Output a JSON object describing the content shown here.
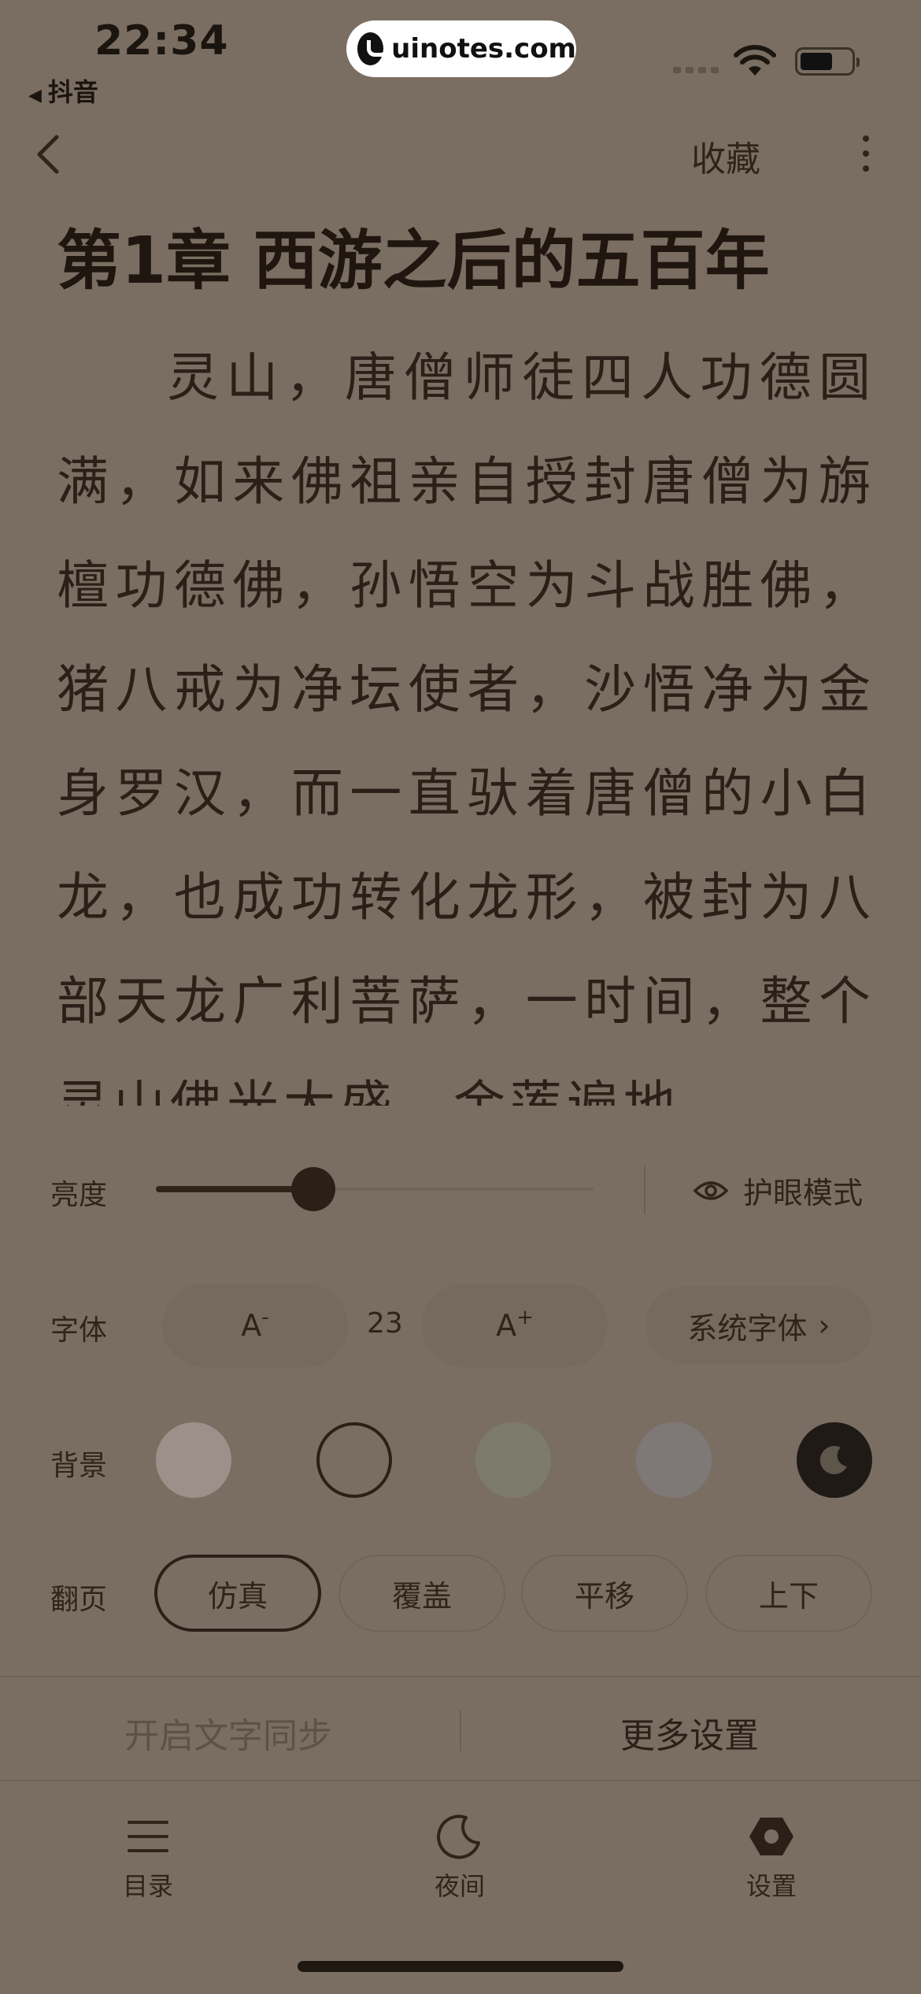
{
  "status_bar": {
    "time": "22:34",
    "back_app": "抖音",
    "watermark": "uinotes.com"
  },
  "header": {
    "favorite_label": "收藏"
  },
  "reader": {
    "chapter_title": "第1章 西游之后的五百年",
    "paragraph": "灵山，唐僧师徒四人功德圆满，如来佛祖亲自授封唐僧为旃檀功德佛，孙悟空为斗战胜佛，猪八戒为净坛使者，沙悟净为金身罗汉，而一直驮着唐僧的小白龙，也成功转化龙形，被封为八部天龙广利菩萨，一时间，整个灵山佛光大盛，金莲遍地"
  },
  "settings": {
    "brightness": {
      "label": "亮度",
      "level": 0.36,
      "eye_mode_label": "护眼模式"
    },
    "font": {
      "label": "字体",
      "decrease": "A",
      "decrease_sup": "-",
      "size": "23",
      "increase": "A",
      "increase_sup": "+",
      "system_font": "系统字体"
    },
    "background": {
      "label": "背景",
      "swatches": [
        {
          "name": "light",
          "color": "#9b918a"
        },
        {
          "name": "beige",
          "color": "#7a6e62"
        },
        {
          "name": "green",
          "color": "#7d7b6b"
        },
        {
          "name": "gray",
          "color": "#7e7877"
        },
        {
          "name": "night",
          "color": "#1f1a15"
        }
      ],
      "selected": "beige"
    },
    "page_turn": {
      "label": "翻页",
      "options": [
        "仿真",
        "覆盖",
        "平移",
        "上下"
      ],
      "selected": "仿真"
    },
    "sync_text": "开启文字同步",
    "more_settings": "更多设置"
  },
  "tabs": [
    {
      "label": "目录",
      "icon": "menu-icon"
    },
    {
      "label": "夜间",
      "icon": "moon-icon"
    },
    {
      "label": "设置",
      "icon": "settings-hex-icon"
    }
  ]
}
